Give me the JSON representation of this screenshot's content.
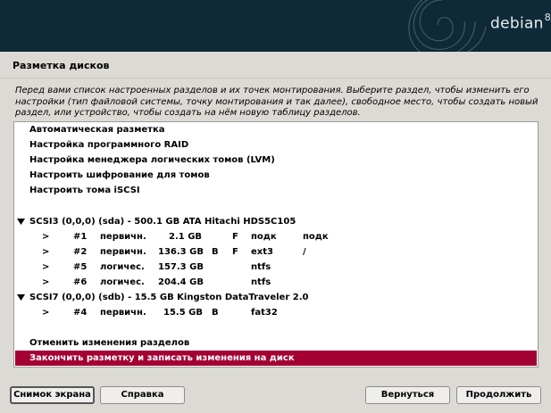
{
  "banner": {
    "brand": "debian",
    "version": "8"
  },
  "page": {
    "title": "Разметка дисков",
    "intro": "Перед вами список настроенных разделов и их точек монтирования. Выберите раздел, чтобы изменить его настройки (тип файловой системы, точку монтирования и так далее), свободное место, чтобы создать новый раздел, или устройство, чтобы создать на нём новую таблицу разделов."
  },
  "menu_items": [
    "Автоматическая разметка",
    "Настройка программного RAID",
    "Настройка менеджера логических томов (LVM)",
    "Настроить шифрование для томов",
    "Настроить тома iSCSI"
  ],
  "disks": [
    {
      "label": "SCSI3 (0,0,0) (sda) - 500.1 GB ATA Hitachi HDS5C105",
      "partitions": [
        {
          "arrow": ">",
          "num": "#1",
          "type": "первичн.",
          "size": "2.1 GB",
          "boot": "",
          "format": "F",
          "fs": "подк",
          "mount": "подк"
        },
        {
          "arrow": ">",
          "num": "#2",
          "type": "первичн.",
          "size": "136.3 GB",
          "boot": "B",
          "format": "F",
          "fs": "ext3",
          "mount": "/"
        },
        {
          "arrow": ">",
          "num": "#5",
          "type": "логичес.",
          "size": "157.3 GB",
          "boot": "",
          "format": "",
          "fs": "ntfs",
          "mount": ""
        },
        {
          "arrow": ">",
          "num": "#6",
          "type": "логичес.",
          "size": "204.4 GB",
          "boot": "",
          "format": "",
          "fs": "ntfs",
          "mount": ""
        }
      ]
    },
    {
      "label": "SCSI7 (0,0,0) (sdb) - 15.5 GB Kingston DataTraveler 2.0",
      "partitions": [
        {
          "arrow": ">",
          "num": "#4",
          "type": "первичн.",
          "size": "15.5 GB",
          "boot": "B",
          "format": "",
          "fs": "fat32",
          "mount": ""
        }
      ]
    }
  ],
  "actions": {
    "undo": "Отменить изменения разделов",
    "finish": "Закончить разметку и записать изменения на диск"
  },
  "buttons": {
    "screenshot": "Снимок экрана",
    "help": "Справка",
    "back": "Вернуться",
    "continue": "Продолжить"
  },
  "colors": {
    "banner": "#0e2a38",
    "selection": "#a30033"
  }
}
